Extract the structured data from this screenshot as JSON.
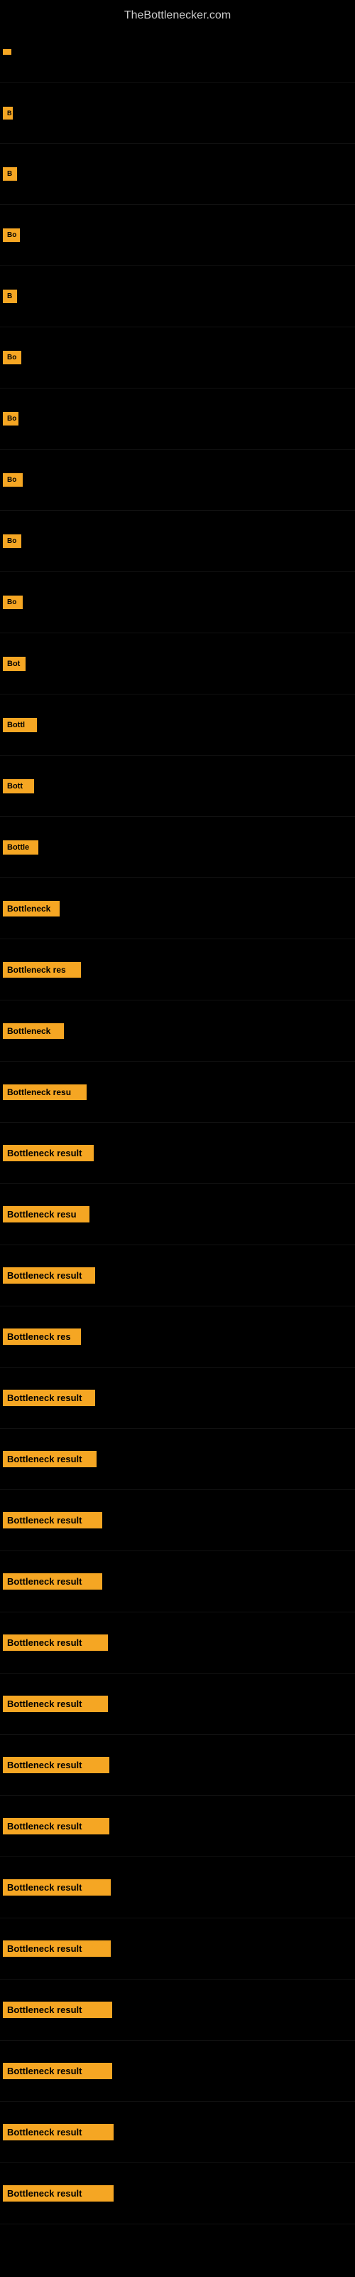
{
  "site": {
    "title": "TheBottlenecker.com"
  },
  "items": [
    {
      "id": 0,
      "label": ""
    },
    {
      "id": 1,
      "label": "B"
    },
    {
      "id": 2,
      "label": "B"
    },
    {
      "id": 3,
      "label": "Bo"
    },
    {
      "id": 4,
      "label": "B"
    },
    {
      "id": 5,
      "label": "Bo"
    },
    {
      "id": 6,
      "label": "Bo"
    },
    {
      "id": 7,
      "label": "Bo"
    },
    {
      "id": 8,
      "label": "Bo"
    },
    {
      "id": 9,
      "label": "Bo"
    },
    {
      "id": 10,
      "label": "Bot"
    },
    {
      "id": 11,
      "label": "Bottl"
    },
    {
      "id": 12,
      "label": "Bott"
    },
    {
      "id": 13,
      "label": "Bottle"
    },
    {
      "id": 14,
      "label": "Bottleneck"
    },
    {
      "id": 15,
      "label": "Bottleneck res"
    },
    {
      "id": 16,
      "label": "Bottleneck"
    },
    {
      "id": 17,
      "label": "Bottleneck resu"
    },
    {
      "id": 18,
      "label": "Bottleneck result"
    },
    {
      "id": 19,
      "label": "Bottleneck resu"
    },
    {
      "id": 20,
      "label": "Bottleneck result"
    },
    {
      "id": 21,
      "label": "Bottleneck res"
    },
    {
      "id": 22,
      "label": "Bottleneck result"
    },
    {
      "id": 23,
      "label": "Bottleneck result"
    },
    {
      "id": 24,
      "label": "Bottleneck result"
    },
    {
      "id": 25,
      "label": "Bottleneck result"
    },
    {
      "id": 26,
      "label": "Bottleneck result"
    },
    {
      "id": 27,
      "label": "Bottleneck result"
    },
    {
      "id": 28,
      "label": "Bottleneck result"
    },
    {
      "id": 29,
      "label": "Bottleneck result"
    },
    {
      "id": 30,
      "label": "Bottleneck result"
    },
    {
      "id": 31,
      "label": "Bottleneck result"
    },
    {
      "id": 32,
      "label": "Bottleneck result"
    },
    {
      "id": 33,
      "label": "Bottleneck result"
    },
    {
      "id": 34,
      "label": "Bottleneck result"
    },
    {
      "id": 35,
      "label": "Bottleneck result"
    }
  ]
}
